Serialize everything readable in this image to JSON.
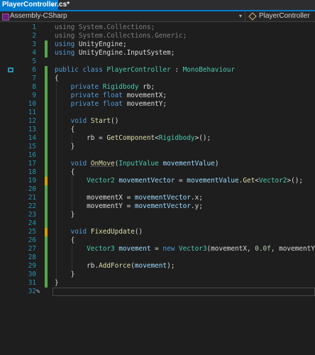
{
  "tab": {
    "title": "PlayerController.cs*",
    "close_glyph": "×"
  },
  "navbar": {
    "project": "Assembly-CSharp",
    "class_name": "PlayerController",
    "dropdown_glyph": "▾"
  },
  "pencil_glyph": "✎",
  "colors": {
    "accent": "#007acc",
    "line_number": "#2b91af",
    "saved_change": "#57a64a",
    "unsaved_change": "#d69d00",
    "keyword": "#569cd6",
    "type": "#4ec9b0",
    "method": "#dcdcaa",
    "local": "#9cdcfe",
    "number": "#b5cea8"
  },
  "lines": [
    {
      "n": "1",
      "chg": "",
      "tokens": [
        {
          "t": "using ",
          "c": "dim"
        },
        {
          "t": "System",
          "c": "dim"
        },
        {
          "t": ".",
          "c": "dim"
        },
        {
          "t": "Collections",
          "c": "dim"
        },
        {
          "t": ";",
          "c": "dim"
        }
      ]
    },
    {
      "n": "2",
      "chg": "",
      "tokens": [
        {
          "t": "using ",
          "c": "dim"
        },
        {
          "t": "System.Collections.Generic;",
          "c": "dim"
        }
      ]
    },
    {
      "n": "3",
      "chg": "saved",
      "tokens": [
        {
          "t": "using ",
          "c": "kw"
        },
        {
          "t": "UnityEngine;",
          "c": "ns"
        }
      ]
    },
    {
      "n": "4",
      "chg": "saved",
      "tokens": [
        {
          "t": "using ",
          "c": "kw"
        },
        {
          "t": "UnityEngine.InputSystem;",
          "c": "ns"
        }
      ]
    },
    {
      "n": "5",
      "chg": "",
      "tokens": []
    },
    {
      "n": "6",
      "chg": "saved",
      "marker": true,
      "tokens": [
        {
          "t": "public ",
          "c": "kw"
        },
        {
          "t": "class ",
          "c": "kw"
        },
        {
          "t": "PlayerController",
          "c": "cls"
        },
        {
          "t": " : ",
          "c": "pun"
        },
        {
          "t": "MonoBehaviour",
          "c": "cls"
        }
      ]
    },
    {
      "n": "7",
      "chg": "saved",
      "tokens": [
        {
          "t": "{",
          "c": "pun"
        }
      ]
    },
    {
      "n": "8",
      "chg": "saved",
      "tokens": [
        {
          "t": "    private ",
          "c": "kw"
        },
        {
          "t": "Rigidbody",
          "c": "cls"
        },
        {
          "t": " rb;",
          "c": "fld"
        }
      ]
    },
    {
      "n": "9",
      "chg": "saved",
      "tokens": [
        {
          "t": "    private ",
          "c": "kw"
        },
        {
          "t": "float ",
          "c": "kw"
        },
        {
          "t": "movementX;",
          "c": "fld"
        }
      ]
    },
    {
      "n": "10",
      "chg": "saved",
      "tokens": [
        {
          "t": "    private ",
          "c": "kw"
        },
        {
          "t": "float ",
          "c": "kw"
        },
        {
          "t": "movementY;",
          "c": "fld"
        }
      ]
    },
    {
      "n": "11",
      "chg": "saved",
      "tokens": []
    },
    {
      "n": "12",
      "chg": "saved",
      "tokens": [
        {
          "t": "    void ",
          "c": "kw"
        },
        {
          "t": "Start",
          "c": "mth"
        },
        {
          "t": "()",
          "c": "pun"
        }
      ]
    },
    {
      "n": "13",
      "chg": "saved",
      "tokens": [
        {
          "t": "    {",
          "c": "pun"
        }
      ]
    },
    {
      "n": "14",
      "chg": "saved",
      "tokens": [
        {
          "t": "        rb = ",
          "c": "fld"
        },
        {
          "t": "GetComponent",
          "c": "mth"
        },
        {
          "t": "<",
          "c": "pun"
        },
        {
          "t": "Rigidbody",
          "c": "cls"
        },
        {
          "t": ">();",
          "c": "pun"
        }
      ]
    },
    {
      "n": "15",
      "chg": "saved",
      "tokens": [
        {
          "t": "    }",
          "c": "pun"
        }
      ]
    },
    {
      "n": "16",
      "chg": "saved",
      "tokens": []
    },
    {
      "n": "17",
      "chg": "saved",
      "tokens": [
        {
          "t": "    void ",
          "c": "kw"
        },
        {
          "t": "OnMove",
          "c": "mth",
          "u": true
        },
        {
          "t": "(",
          "c": "pun"
        },
        {
          "t": "InputValue",
          "c": "cls"
        },
        {
          "t": " ",
          "c": "pun"
        },
        {
          "t": "movementValue",
          "c": "loc"
        },
        {
          "t": ")",
          "c": "pun"
        }
      ]
    },
    {
      "n": "18",
      "chg": "saved",
      "tokens": [
        {
          "t": "    {",
          "c": "pun"
        }
      ]
    },
    {
      "n": "19",
      "chg": "unsaved",
      "tokens": [
        {
          "t": "        Vector2",
          "c": "cls"
        },
        {
          "t": " ",
          "c": "pun"
        },
        {
          "t": "movementVector",
          "c": "loc"
        },
        {
          "t": " = ",
          "c": "pun"
        },
        {
          "t": "movementValue",
          "c": "loc"
        },
        {
          "t": ".",
          "c": "pun"
        },
        {
          "t": "Get",
          "c": "mth"
        },
        {
          "t": "<",
          "c": "pun"
        },
        {
          "t": "Vector2",
          "c": "cls"
        },
        {
          "t": ">();",
          "c": "pun"
        }
      ]
    },
    {
      "n": "20",
      "chg": "saved",
      "tokens": []
    },
    {
      "n": "21",
      "chg": "saved",
      "tokens": [
        {
          "t": "        movementX = ",
          "c": "fld"
        },
        {
          "t": "movementVector",
          "c": "loc"
        },
        {
          "t": ".x;",
          "c": "fld"
        }
      ]
    },
    {
      "n": "22",
      "chg": "saved",
      "tokens": [
        {
          "t": "        movementY = ",
          "c": "fld"
        },
        {
          "t": "movementVector",
          "c": "loc"
        },
        {
          "t": ".y;",
          "c": "fld"
        }
      ]
    },
    {
      "n": "23",
      "chg": "saved",
      "tokens": [
        {
          "t": "    }",
          "c": "pun"
        }
      ]
    },
    {
      "n": "24",
      "chg": "saved",
      "tokens": []
    },
    {
      "n": "25",
      "chg": "unsaved",
      "tokens": [
        {
          "t": "    void ",
          "c": "kw"
        },
        {
          "t": "FixedUpdate",
          "c": "mth"
        },
        {
          "t": "()",
          "c": "pun"
        }
      ]
    },
    {
      "n": "26",
      "chg": "saved",
      "tokens": [
        {
          "t": "    {",
          "c": "pun"
        }
      ]
    },
    {
      "n": "27",
      "chg": "saved",
      "tokens": [
        {
          "t": "        Vector3",
          "c": "cls"
        },
        {
          "t": " ",
          "c": "pun"
        },
        {
          "t": "movement",
          "c": "loc"
        },
        {
          "t": " = ",
          "c": "pun"
        },
        {
          "t": "new ",
          "c": "kw"
        },
        {
          "t": "Vector3",
          "c": "cls"
        },
        {
          "t": "(movementX, ",
          "c": "pun"
        },
        {
          "t": "0.0f",
          "c": "num"
        },
        {
          "t": ", movementY);",
          "c": "pun"
        }
      ]
    },
    {
      "n": "28",
      "chg": "saved",
      "tokens": []
    },
    {
      "n": "29",
      "chg": "saved",
      "tokens": [
        {
          "t": "        rb.",
          "c": "fld"
        },
        {
          "t": "AddForce",
          "c": "mth"
        },
        {
          "t": "(",
          "c": "pun"
        },
        {
          "t": "movement",
          "c": "loc"
        },
        {
          "t": ");",
          "c": "pun"
        }
      ]
    },
    {
      "n": "30",
      "chg": "saved",
      "tokens": [
        {
          "t": "    }",
          "c": "pun"
        }
      ]
    },
    {
      "n": "31",
      "chg": "saved",
      "tokens": [
        {
          "t": "}",
          "c": "pun"
        }
      ]
    },
    {
      "n": "32",
      "chg": "",
      "pencil": true,
      "cursor": true,
      "tokens": []
    }
  ]
}
